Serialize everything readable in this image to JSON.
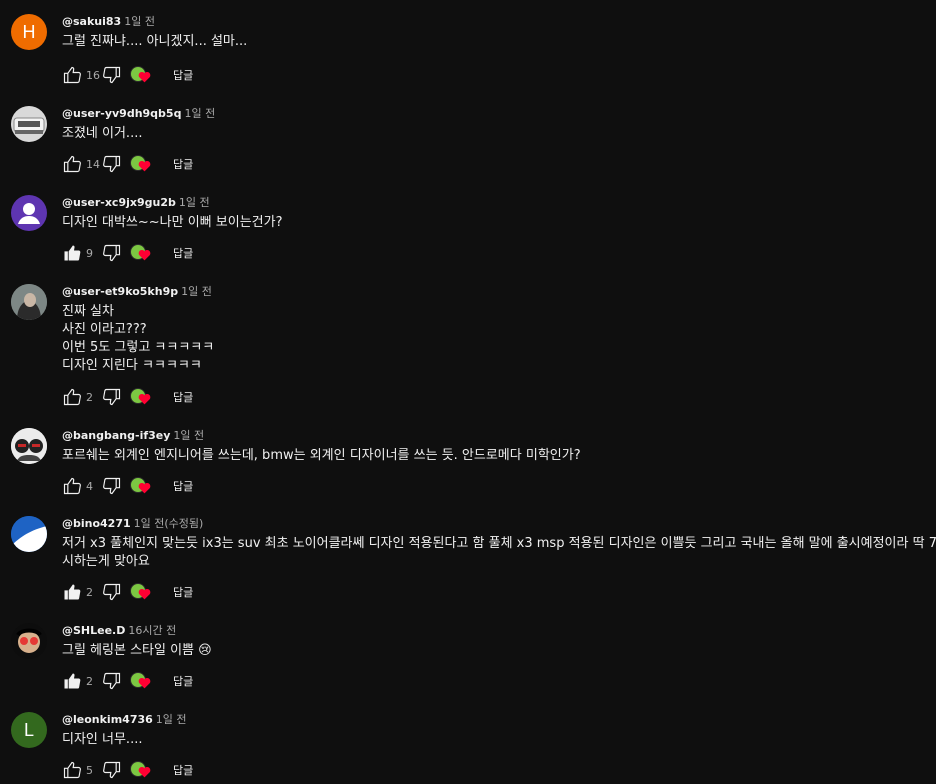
{
  "reply_label": "답글",
  "comments": [
    {
      "handle": "@sakui83",
      "time": "1일 전",
      "lines": [
        "그럴 진짜냐.... 아니겠지... 설마..."
      ],
      "likes": "16",
      "avatar_letter": "H",
      "avatar_color": "#ef6c00",
      "liked": false
    },
    {
      "handle": "@user-yv9dh9qb5q",
      "time": "1일 전",
      "lines": [
        "조졌네 이거...."
      ],
      "likes": "14",
      "avatar_letter": "",
      "avatar_color": "#d8d8d8",
      "liked": false
    },
    {
      "handle": "@user-xc9jx9gu2b",
      "time": "1일 전",
      "lines": [
        "디자인 대박쓰~~나만 이뻐 보이는건가?"
      ],
      "likes": "9",
      "avatar_letter": "",
      "avatar_color": "#5e35b1",
      "liked": true
    },
    {
      "handle": "@user-et9ko5kh9p",
      "time": "1일 전",
      "lines": [
        "진짜 실차",
        "사진 이라고???",
        "이번 5도 그렇고 ㅋㅋㅋㅋㅋ",
        "디자인 지린다 ㅋㅋㅋㅋㅋ"
      ],
      "likes": "2",
      "avatar_letter": "",
      "avatar_color": "#6f7a78",
      "liked": false
    },
    {
      "handle": "@bangbang-if3ey",
      "time": "1일 전",
      "lines": [
        "포르쉐는 외계인 엔지니어를 쓰는데, bmw는 외계인 디자이너를 쓰는 듯. 안드로메다 미학인가?"
      ],
      "likes": "4",
      "avatar_letter": "",
      "avatar_color": "#e9e9e9",
      "liked": false
    },
    {
      "handle": "@bino4271",
      "time": "1일 전(수정됨)",
      "lines": [
        "저거 x3 풀체인지 맞는듯 ix3는 suv 최초 노이어클라쎄 디자인 적용된다고 함 풀체 x3 msp 적용된 디자인은 이쁠듯 그리고 국내는 올해 말에 출시예정이라 딱 7",
        "시하는게 맞아요"
      ],
      "likes": "2",
      "avatar_letter": "",
      "avatar_color": "#1565c0",
      "liked": true
    },
    {
      "handle": "@SHLee.D",
      "time": "16시간 전",
      "lines": [
        "그릴 헤링본 스타일 이쁨 😢"
      ],
      "likes": "2",
      "avatar_letter": "",
      "avatar_color": "#111111",
      "liked": true
    },
    {
      "handle": "@leonkim4736",
      "time": "1일 전",
      "lines": [
        "디자인 너무...."
      ],
      "likes": "5",
      "avatar_letter": "L",
      "avatar_color": "#33691e",
      "liked": false
    }
  ]
}
